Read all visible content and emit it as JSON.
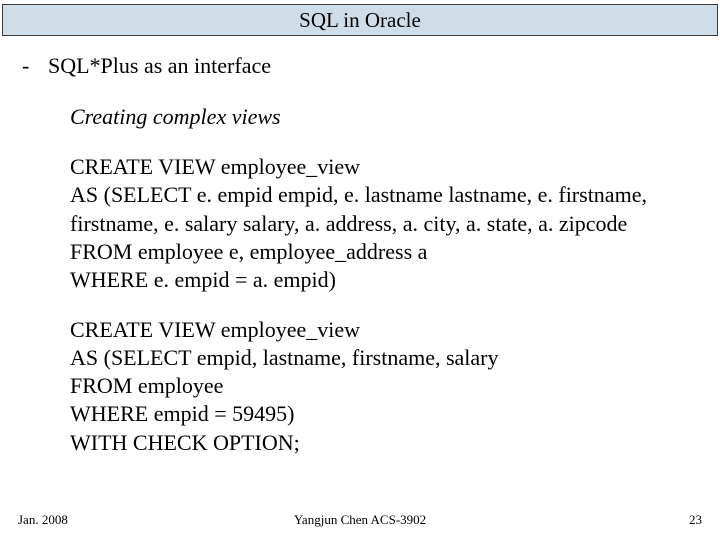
{
  "title": "SQL in Oracle",
  "bullet": {
    "dash": "-",
    "text": "SQL*Plus as an interface"
  },
  "subtitle": "Creating complex views",
  "code1": "CREATE VIEW employee_view\nAS (SELECT e. empid empid, e. lastname lastname, e. firstname, firstname, e. salary salary, a. address, a. city, a. state, a. zipcode\nFROM employee e, employee_address a\nWHERE e. empid = a. empid)",
  "code2": "CREATE VIEW employee_view\nAS (SELECT empid, lastname, firstname, salary\nFROM employee\nWHERE empid = 59495)\nWITH CHECK OPTION;",
  "footer": {
    "left": "Jan. 2008",
    "center": "Yangjun Chen       ACS-3902",
    "right": "23"
  }
}
